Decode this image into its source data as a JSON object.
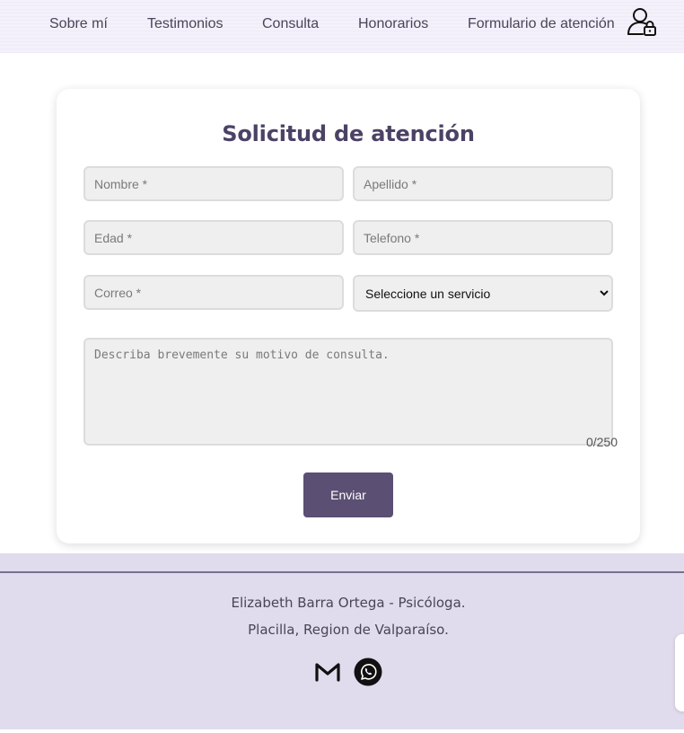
{
  "nav": {
    "items": [
      {
        "label": "Sobre mí"
      },
      {
        "label": "Testimonios"
      },
      {
        "label": "Consulta"
      },
      {
        "label": "Honorarios"
      },
      {
        "label": "Formulario de atención"
      }
    ],
    "account_icon": "user-lock-icon"
  },
  "form": {
    "title": "Solicitud de atención",
    "nombre_placeholder": "Nombre *",
    "apellido_placeholder": "Apellido *",
    "edad_placeholder": "Edad *",
    "telefono_placeholder": "Telefono *",
    "correo_placeholder": "Correo *",
    "servicio_selected": "Seleccione un servicio",
    "motivo_placeholder": "Describa brevemente su motivo de consulta.",
    "char_counter": "0/250",
    "submit_label": "Enviar"
  },
  "footer": {
    "name_line": "Elizabeth Barra Ortega - Psicóloga.",
    "location_line": "Placilla, Region de Valparaíso.",
    "icons": [
      "gmail-icon",
      "whatsapp-icon"
    ]
  },
  "colors": {
    "nav_bg": "#f4f1fb",
    "accent": "#5b4f73",
    "title": "#4c4266",
    "footer_bg": "#e0dced"
  }
}
